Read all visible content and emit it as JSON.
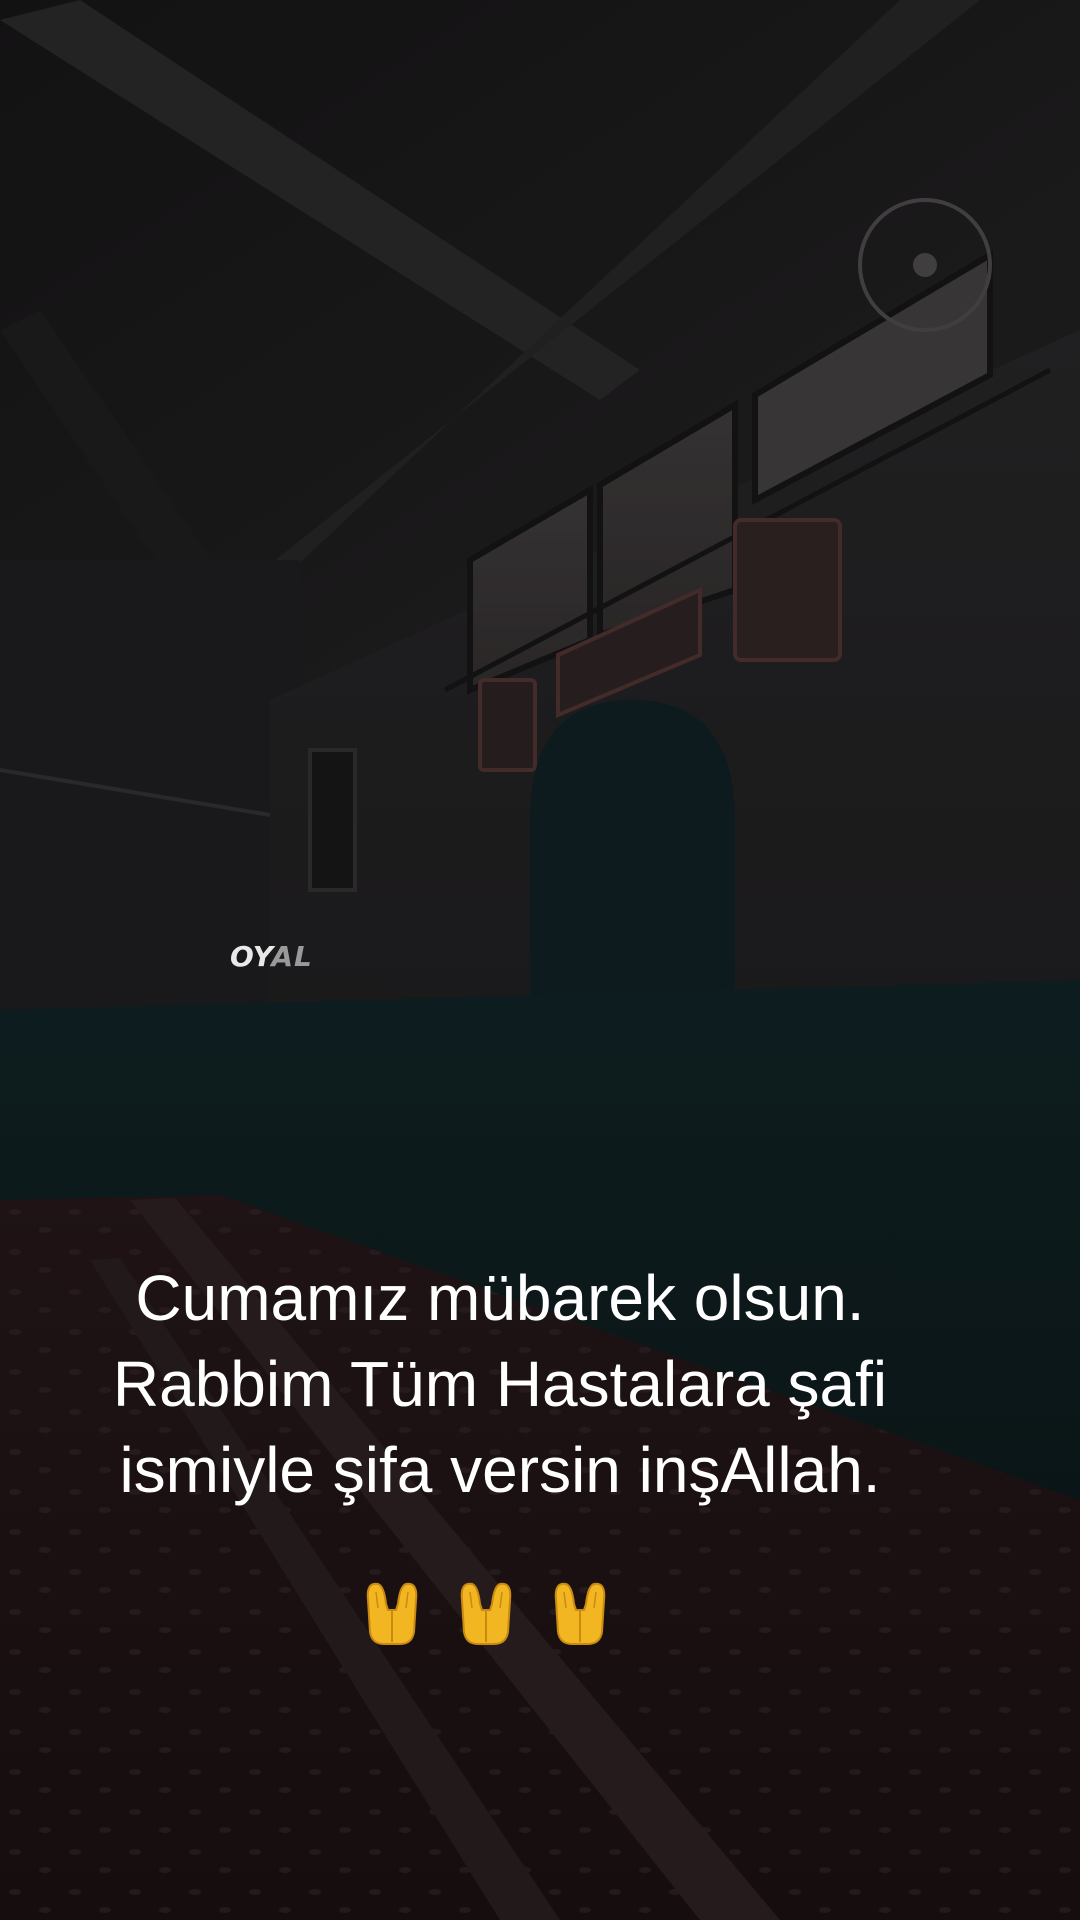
{
  "watermark": {
    "part1": "OY",
    "part2": "AL"
  },
  "caption": {
    "line1": "Cumamız mübarek olsun.",
    "line2": "Rabbim Tüm Hastalara şafi",
    "line3": "ismiyle şifa versin inşAllah."
  },
  "emoji": {
    "icon": "palms-up-together-icon",
    "count": 3
  },
  "colors": {
    "caption_text": "#ffffff",
    "wall": "#2a292b",
    "lower_wall": "#13282a",
    "carpet": "#2a1a1c",
    "emoji": "#f3b623"
  }
}
